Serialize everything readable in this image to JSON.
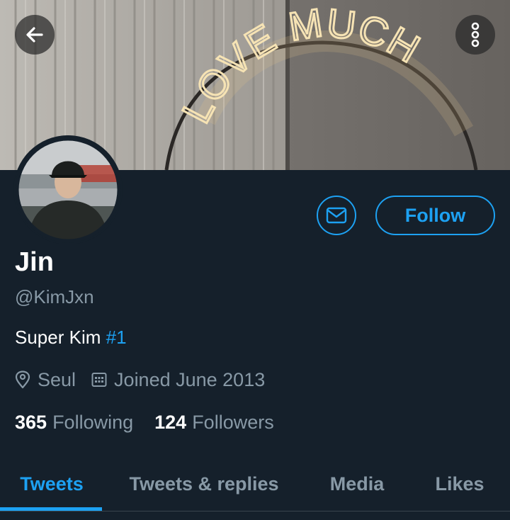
{
  "banner": {
    "neon_text": "LOVE MUCH"
  },
  "profile": {
    "display_name": "Jin",
    "handle": "@KimJxn",
    "bio_text": "Super Kim ",
    "bio_hashtag": "#1",
    "location": "Seul",
    "joined": "Joined June 2013",
    "following_count": "365",
    "following_label": "Following",
    "followers_count": "124",
    "followers_label": "Followers"
  },
  "actions": {
    "follow_label": "Follow"
  },
  "tabs": [
    {
      "label": "Tweets",
      "active": true
    },
    {
      "label": "Tweets & replies",
      "active": false
    },
    {
      "label": "Media",
      "active": false
    },
    {
      "label": "Likes",
      "active": false
    }
  ],
  "colors": {
    "background": "#15202b",
    "accent": "#1da1f2",
    "secondary_text": "#8899a6",
    "primary_text": "#ffffff"
  },
  "icons": {
    "back": "arrow-left-icon",
    "more": "more-vertical-icon",
    "message": "envelope-icon",
    "location": "map-pin-icon",
    "joined": "calendar-icon"
  }
}
